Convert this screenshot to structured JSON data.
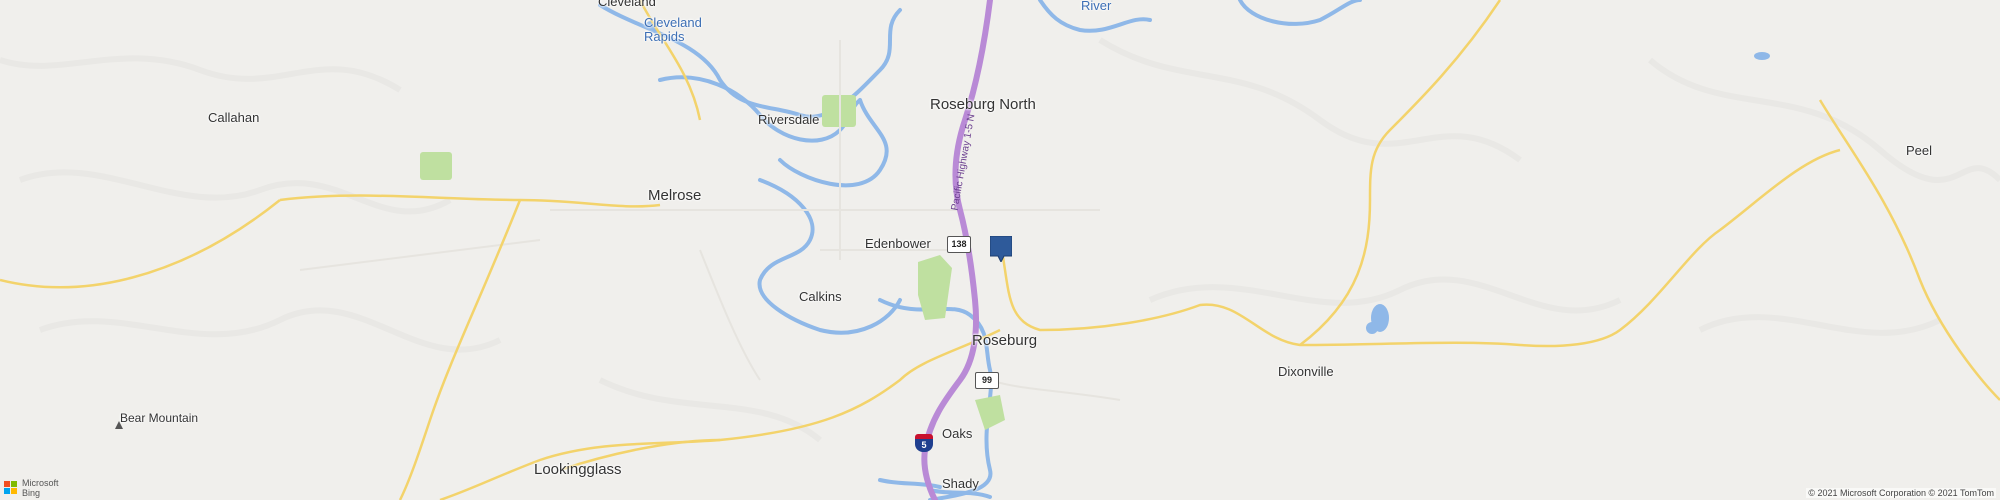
{
  "map": {
    "places": {
      "cleveland": "Cleveland",
      "cleveland_rapids": "Cleveland\nRapids",
      "callahan": "Callahan",
      "riversdale": "Riversdale",
      "roseburg_north": "Roseburg North",
      "melrose": "Melrose",
      "edenbower": "Edenbower",
      "calkins": "Calkins",
      "roseburg": "Roseburg",
      "dixonville": "Dixonville",
      "peel": "Peel",
      "bear_mountain": "Bear Mountain",
      "lookingglass": "Lookingglass",
      "oaks": "Oaks",
      "shady": "Shady",
      "river": "River"
    },
    "highway_label": "Pacific Highway 1-5 N",
    "shields": {
      "route_138": "138",
      "route_99": "99",
      "interstate_5": "5"
    },
    "colors": {
      "land": "#f0efec",
      "water": "#8fb8e8",
      "interstate": "#b98ad6",
      "major_road": "#f3d36b",
      "park": "#bfe0a0",
      "marker": "#2e5a9a"
    }
  },
  "branding": {
    "logo_line1": "Microsoft",
    "logo_line2": "Bing"
  },
  "copyright": "© 2021 Microsoft Corporation © 2021 TomTom"
}
